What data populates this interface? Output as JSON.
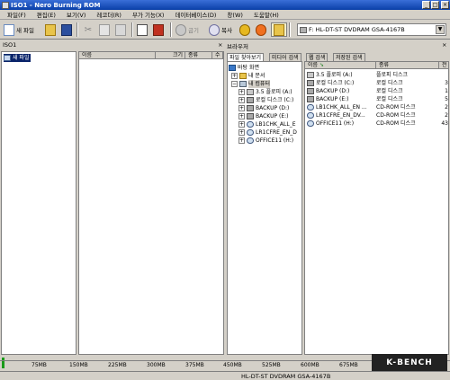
{
  "window": {
    "title": "ISO1 - Nero Burning ROM"
  },
  "menu": [
    "파일(F)",
    "편집(E)",
    "보기(V)",
    "레코더(R)",
    "부가 기능(X)",
    "데이터베이스(D)",
    "창(W)",
    "도움말(H)"
  ],
  "toolbar": {
    "new_label": "새 파일",
    "burn_label": "굽기",
    "copy_label": "복사",
    "drive": "F: HL-DT-ST DVDRAM GSA-4167B"
  },
  "left_pane": {
    "title": "ISO1",
    "item": "새 파일"
  },
  "compilation": {
    "columns": [
      "이름",
      "크기",
      "종류",
      "수"
    ]
  },
  "browser": {
    "title": "브라우저",
    "tabs": [
      "파일 찾아보기",
      "미디어 검색",
      "웹 검색",
      "저장된 검색"
    ],
    "tree": [
      {
        "label": "바탕 화면",
        "icon": "desktop-icon"
      },
      {
        "label": "내 문서",
        "icon": "folder-icon"
      },
      {
        "label": "내 컴퓨터",
        "icon": "computer-icon"
      },
      {
        "label": "3.5 플로피 (A:)",
        "icon": "floppy-icon"
      },
      {
        "label": "로컬 디스크 (C:)",
        "icon": "disk-icon"
      },
      {
        "label": "BACKUP (D:)",
        "icon": "disk-icon"
      },
      {
        "label": "BACKUP (E:)",
        "icon": "disk-icon"
      },
      {
        "label": "LB1CHK_ALL_E",
        "icon": "cd-icon"
      },
      {
        "label": "LR1CFRE_EN_D",
        "icon": "cd-icon"
      },
      {
        "label": "OFFICE11 (H:)",
        "icon": "cd-icon"
      }
    ],
    "list_columns": [
      "이름",
      "종류",
      "전"
    ],
    "list": [
      {
        "name": "3.5 플로피 (A:)",
        "type": "플로피 디스크",
        "extra": ""
      },
      {
        "name": "로컬 디스크 (C:)",
        "type": "로컬 디스크",
        "extra": "3"
      },
      {
        "name": "BACKUP (D:)",
        "type": "로컬 디스크",
        "extra": "1"
      },
      {
        "name": "BACKUP (E:)",
        "type": "로컬 디스크",
        "extra": "5"
      },
      {
        "name": "LB1CHK_ALL_EN ...",
        "type": "CD-ROM 디스크",
        "extra": "2"
      },
      {
        "name": "LR1CFRE_EN_DV...",
        "type": "CD-ROM 디스크",
        "extra": "2"
      },
      {
        "name": "OFFICE11 (H:)",
        "type": "CD-ROM 디스크",
        "extra": "43"
      }
    ]
  },
  "scale": [
    "75MB",
    "150MB",
    "225MB",
    "300MB",
    "375MB",
    "450MB",
    "525MB",
    "600MB",
    "675MB"
  ],
  "status": {
    "drive": "HL-DT-ST DVDRAM GSA-4167B"
  },
  "logo": "K-BENCH"
}
